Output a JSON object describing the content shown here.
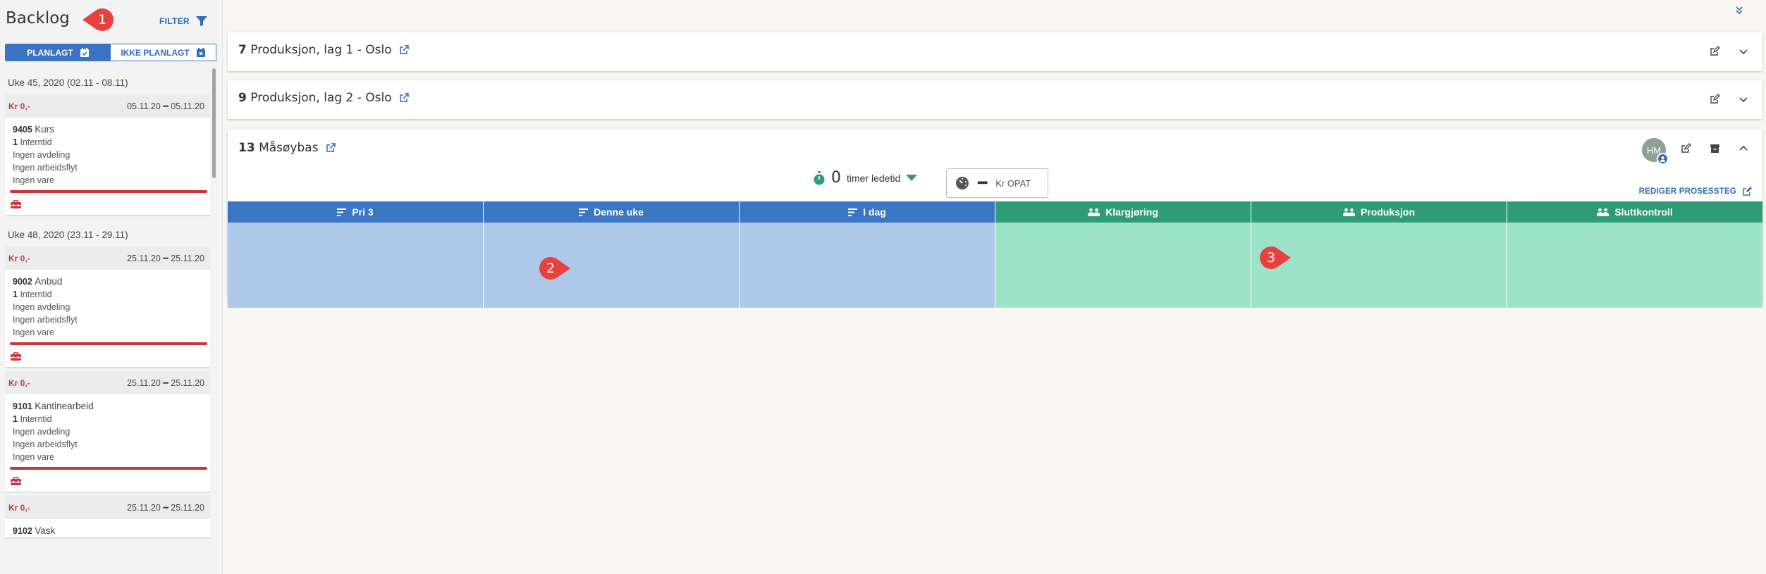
{
  "sidebar": {
    "title": "Backlog",
    "filter_label": "FILTER",
    "toggle": {
      "planned": "PLANLAGT",
      "unplanned": "IKKE PLANLAGT"
    },
    "groups": [
      {
        "week": "Uke 45, 2020 (02.11 - 08.11)",
        "cards": [
          {
            "kr": "Kr 0,-",
            "dates": "05.11.20 ━ 05.11.20",
            "number": "9405",
            "name": "Kurs",
            "internal_count": "1",
            "internal_label": "Interntid",
            "department": "Ingen avdeling",
            "workflow": "Ingen arbeidsflyt",
            "item": "Ingen vare"
          }
        ]
      },
      {
        "week": "Uke 48, 2020 (23.11 - 29.11)",
        "cards": [
          {
            "kr": "Kr 0,-",
            "dates": "25.11.20 ━ 25.11.20",
            "number": "9002",
            "name": "Anbud",
            "internal_count": "1",
            "internal_label": "Interntid",
            "department": "Ingen avdeling",
            "workflow": "Ingen arbeidsflyt",
            "item": "Ingen vare"
          },
          {
            "kr": "Kr 0,-",
            "dates": "25.11.20 ━ 25.11.20",
            "number": "9101",
            "name": "Kantinearbeid",
            "internal_count": "1",
            "internal_label": "Interntid",
            "department": "Ingen avdeling",
            "workflow": "Ingen arbeidsflyt",
            "item": "Ingen vare"
          },
          {
            "kr": "Kr 0,-",
            "dates": "25.11.20 ━ 25.11.20",
            "number": "9102",
            "name": "Vask"
          }
        ]
      }
    ]
  },
  "panels": [
    {
      "number": "7",
      "title": "Produksjon, lag 1 - Oslo"
    },
    {
      "number": "9",
      "title": "Produksjon, lag 2 - Oslo"
    },
    {
      "number": "13",
      "title": "Måsøybas",
      "avatar_initials": "HM",
      "lead_time_value": "0",
      "lead_time_label": "timer ledetid",
      "opat_value": "━",
      "opat_label": "Kr OPAT",
      "edit_steps_label": "REDIGER PROSESSTEG",
      "columns": [
        {
          "label": "Pri 3",
          "kind": "sort",
          "color": "#3a76c4"
        },
        {
          "label": "Denne uke",
          "kind": "sort",
          "color": "#3a76c4"
        },
        {
          "label": "I dag",
          "kind": "sort",
          "color": "#3a76c4"
        },
        {
          "label": "Klargjøring",
          "kind": "process",
          "color": "#2e9d77"
        },
        {
          "label": "Produksjon",
          "kind": "process",
          "color": "#2e9d77"
        },
        {
          "label": "Sluttkontroll",
          "kind": "process",
          "color": "#2e9d77"
        }
      ]
    }
  ],
  "markers": [
    "1",
    "2",
    "3"
  ],
  "colors": {
    "accent": "#2d6cc0",
    "price_red": "#c9363a",
    "marker_red": "#e8413d",
    "lead_green": "#2e9d77"
  }
}
